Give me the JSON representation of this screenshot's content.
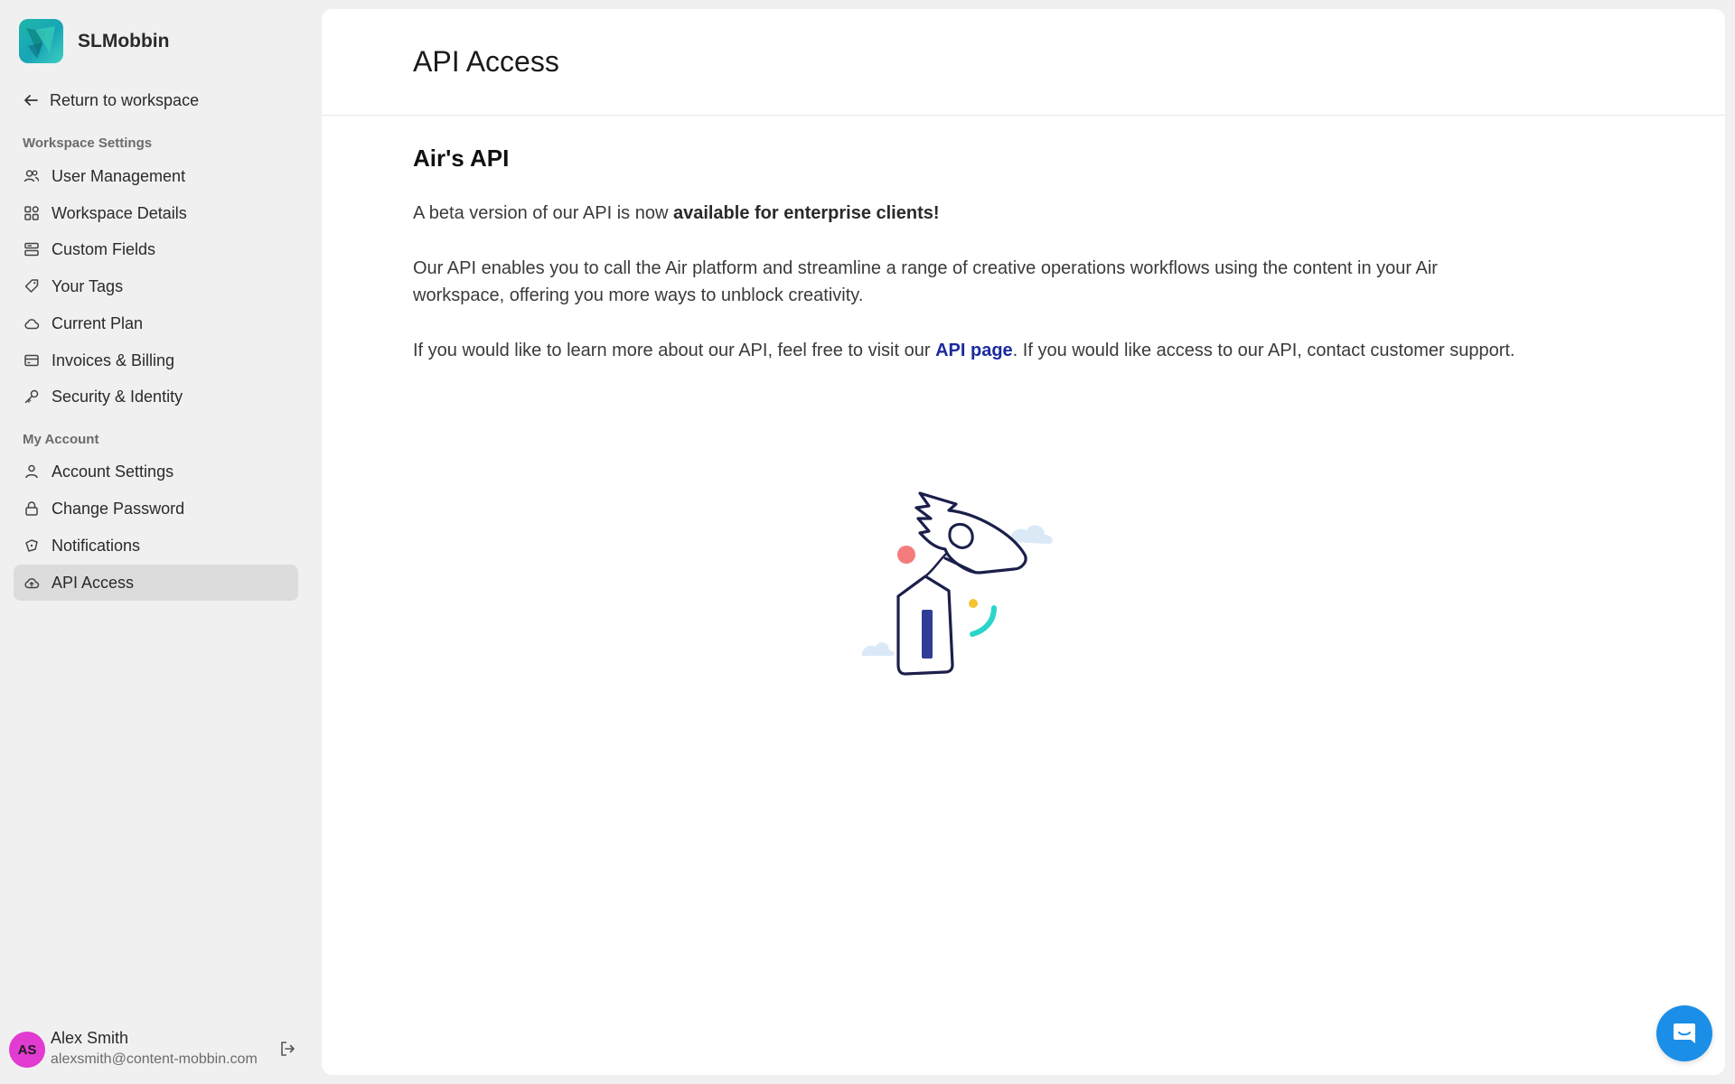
{
  "brand": {
    "name": "SLMobbin"
  },
  "nav": {
    "return_label": "Return to workspace",
    "workspace_section": "Workspace Settings",
    "workspace_items": [
      {
        "label": "User Management",
        "icon": "users-icon"
      },
      {
        "label": "Workspace Details",
        "icon": "grid-icon"
      },
      {
        "label": "Custom Fields",
        "icon": "fields-icon"
      },
      {
        "label": "Your Tags",
        "icon": "tag-icon"
      },
      {
        "label": "Current Plan",
        "icon": "cloud-icon"
      },
      {
        "label": "Invoices & Billing",
        "icon": "card-icon"
      },
      {
        "label": "Security & Identity",
        "icon": "key-icon"
      }
    ],
    "account_section": "My Account",
    "account_items": [
      {
        "label": "Account Settings",
        "icon": "person-icon"
      },
      {
        "label": "Change Password",
        "icon": "lock-icon"
      },
      {
        "label": "Notifications",
        "icon": "bell-icon"
      },
      {
        "label": "API Access",
        "icon": "cloud-upload-icon",
        "active": true
      }
    ]
  },
  "user": {
    "initials": "AS",
    "name": "Alex Smith",
    "email": "alexsmith@content-mobbin.com"
  },
  "page": {
    "title": "API Access",
    "section_title": "Air's API",
    "p1_prefix": "A beta version of our API is now ",
    "p1_bold": "available for enterprise clients!",
    "p2": "Our API enables you to call the Air platform and streamline a range of creative operations workflows using the content in your Air workspace, offering you more ways to unblock creativity.",
    "p3_prefix": "If you would like to learn more about our API, feel free to visit our ",
    "p3_link": "API page",
    "p3_suffix": ". If you would like access to our API, contact customer support."
  },
  "colors": {
    "accent_link": "#1a2a9e",
    "avatar_bg": "#e23bd1",
    "chat_button": "#1b8ee8",
    "active_nav_bg": "#dcdcdc"
  }
}
